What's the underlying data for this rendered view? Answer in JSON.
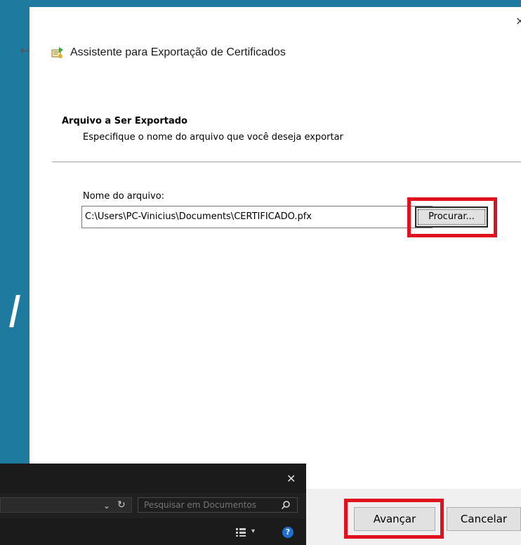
{
  "wizard": {
    "title": "Assistente para Exportação de Certificados",
    "close_glyph": "×",
    "back_glyph": "←",
    "section_heading": "Arquivo a Ser Exportado",
    "section_subtitle": "Especifique o nome do arquivo que você deseja exportar",
    "file_label": "Nome do arquivo:",
    "file_value": "C:\\Users\\PC-Vinicius\\Documents\\CERTIFICADO.pfx",
    "browse_label": "Procurar...",
    "next_label": "Avançar",
    "cancel_label": "Cancelar",
    "icons": [
      "back-arrow-icon",
      "certificate-wizard-icon",
      "close-icon"
    ]
  },
  "explorer": {
    "close_glyph": "✕",
    "address_dropdown_glyph": "⌄",
    "refresh_glyph": "↻",
    "search_placeholder": "Pesquisar em Documentos",
    "view_dropdown_glyph": "▾",
    "help_glyph": "?",
    "icons": [
      "search-icon",
      "view-options-icon",
      "help-icon"
    ]
  },
  "colors": {
    "background": "#1f7aa0",
    "highlight": "#e0101e",
    "explorer_bg": "#1b1b1b",
    "help_blue": "#1e6fd1"
  }
}
